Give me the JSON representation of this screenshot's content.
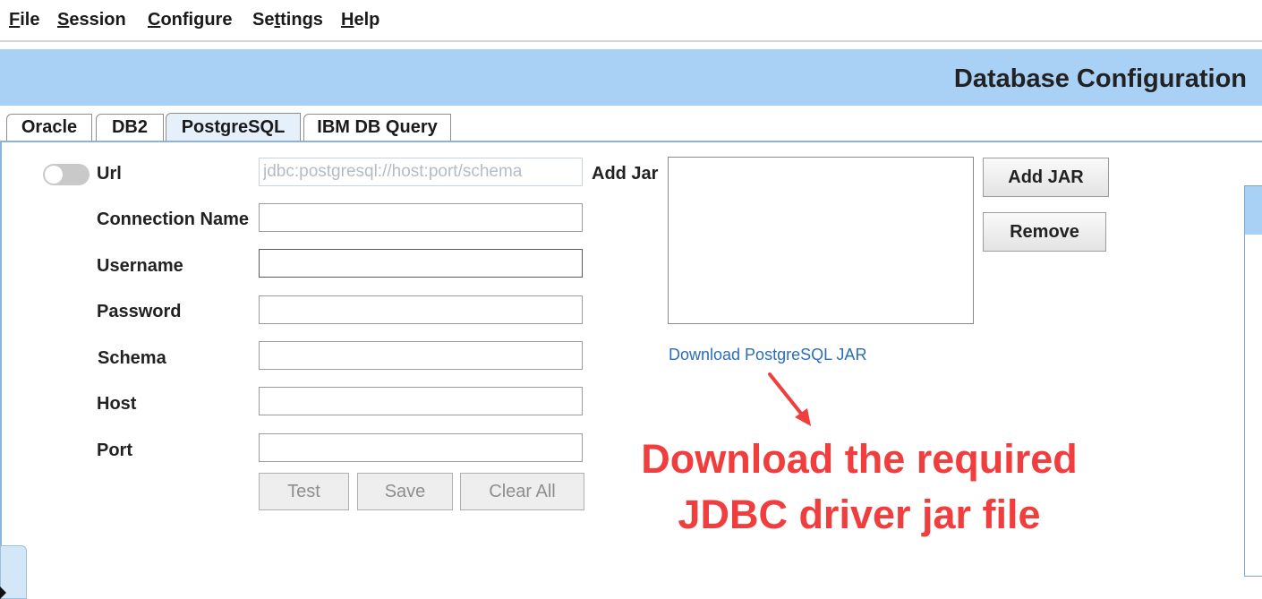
{
  "menu": {
    "items": [
      {
        "first": "F",
        "rest": "ile"
      },
      {
        "first": "S",
        "rest": "ession"
      },
      {
        "first": "C",
        "rest": "onfigure"
      },
      {
        "first": "S",
        "rest": "e",
        "second_u": "t",
        "tail": "tings"
      },
      {
        "first": "H",
        "rest": "elp"
      }
    ]
  },
  "header": {
    "title": "Database Configuration"
  },
  "tabs": [
    "Oracle",
    "DB2",
    "PostgreSQL",
    "IBM DB Query"
  ],
  "active_tab": "PostgreSQL",
  "form": {
    "url_label": "Url",
    "url_placeholder": "jdbc:postgresql://host:port/schema",
    "connection_name_label": "Connection Name",
    "username_label": "Username",
    "password_label": "Password",
    "schema_label": "Schema",
    "host_label": "Host",
    "port_label": "Port",
    "connection_name_value": "",
    "username_value": "",
    "password_value": "",
    "schema_value": "",
    "host_value": "",
    "port_value": ""
  },
  "buttons": {
    "test": "Test",
    "save": "Save",
    "clear_all": "Clear All"
  },
  "jar": {
    "label": "Add Jar",
    "add_button": "Add JAR",
    "remove_button": "Remove",
    "download_link": "Download PostgreSQL JAR"
  },
  "annotation": {
    "line1": "Download the required",
    "line2": "JDBC driver jar file",
    "color": "#f03e3e"
  },
  "colors": {
    "header_bg": "#a9d0f5",
    "link": "#2a6ebb",
    "accent_border": "#8ab4dc"
  }
}
